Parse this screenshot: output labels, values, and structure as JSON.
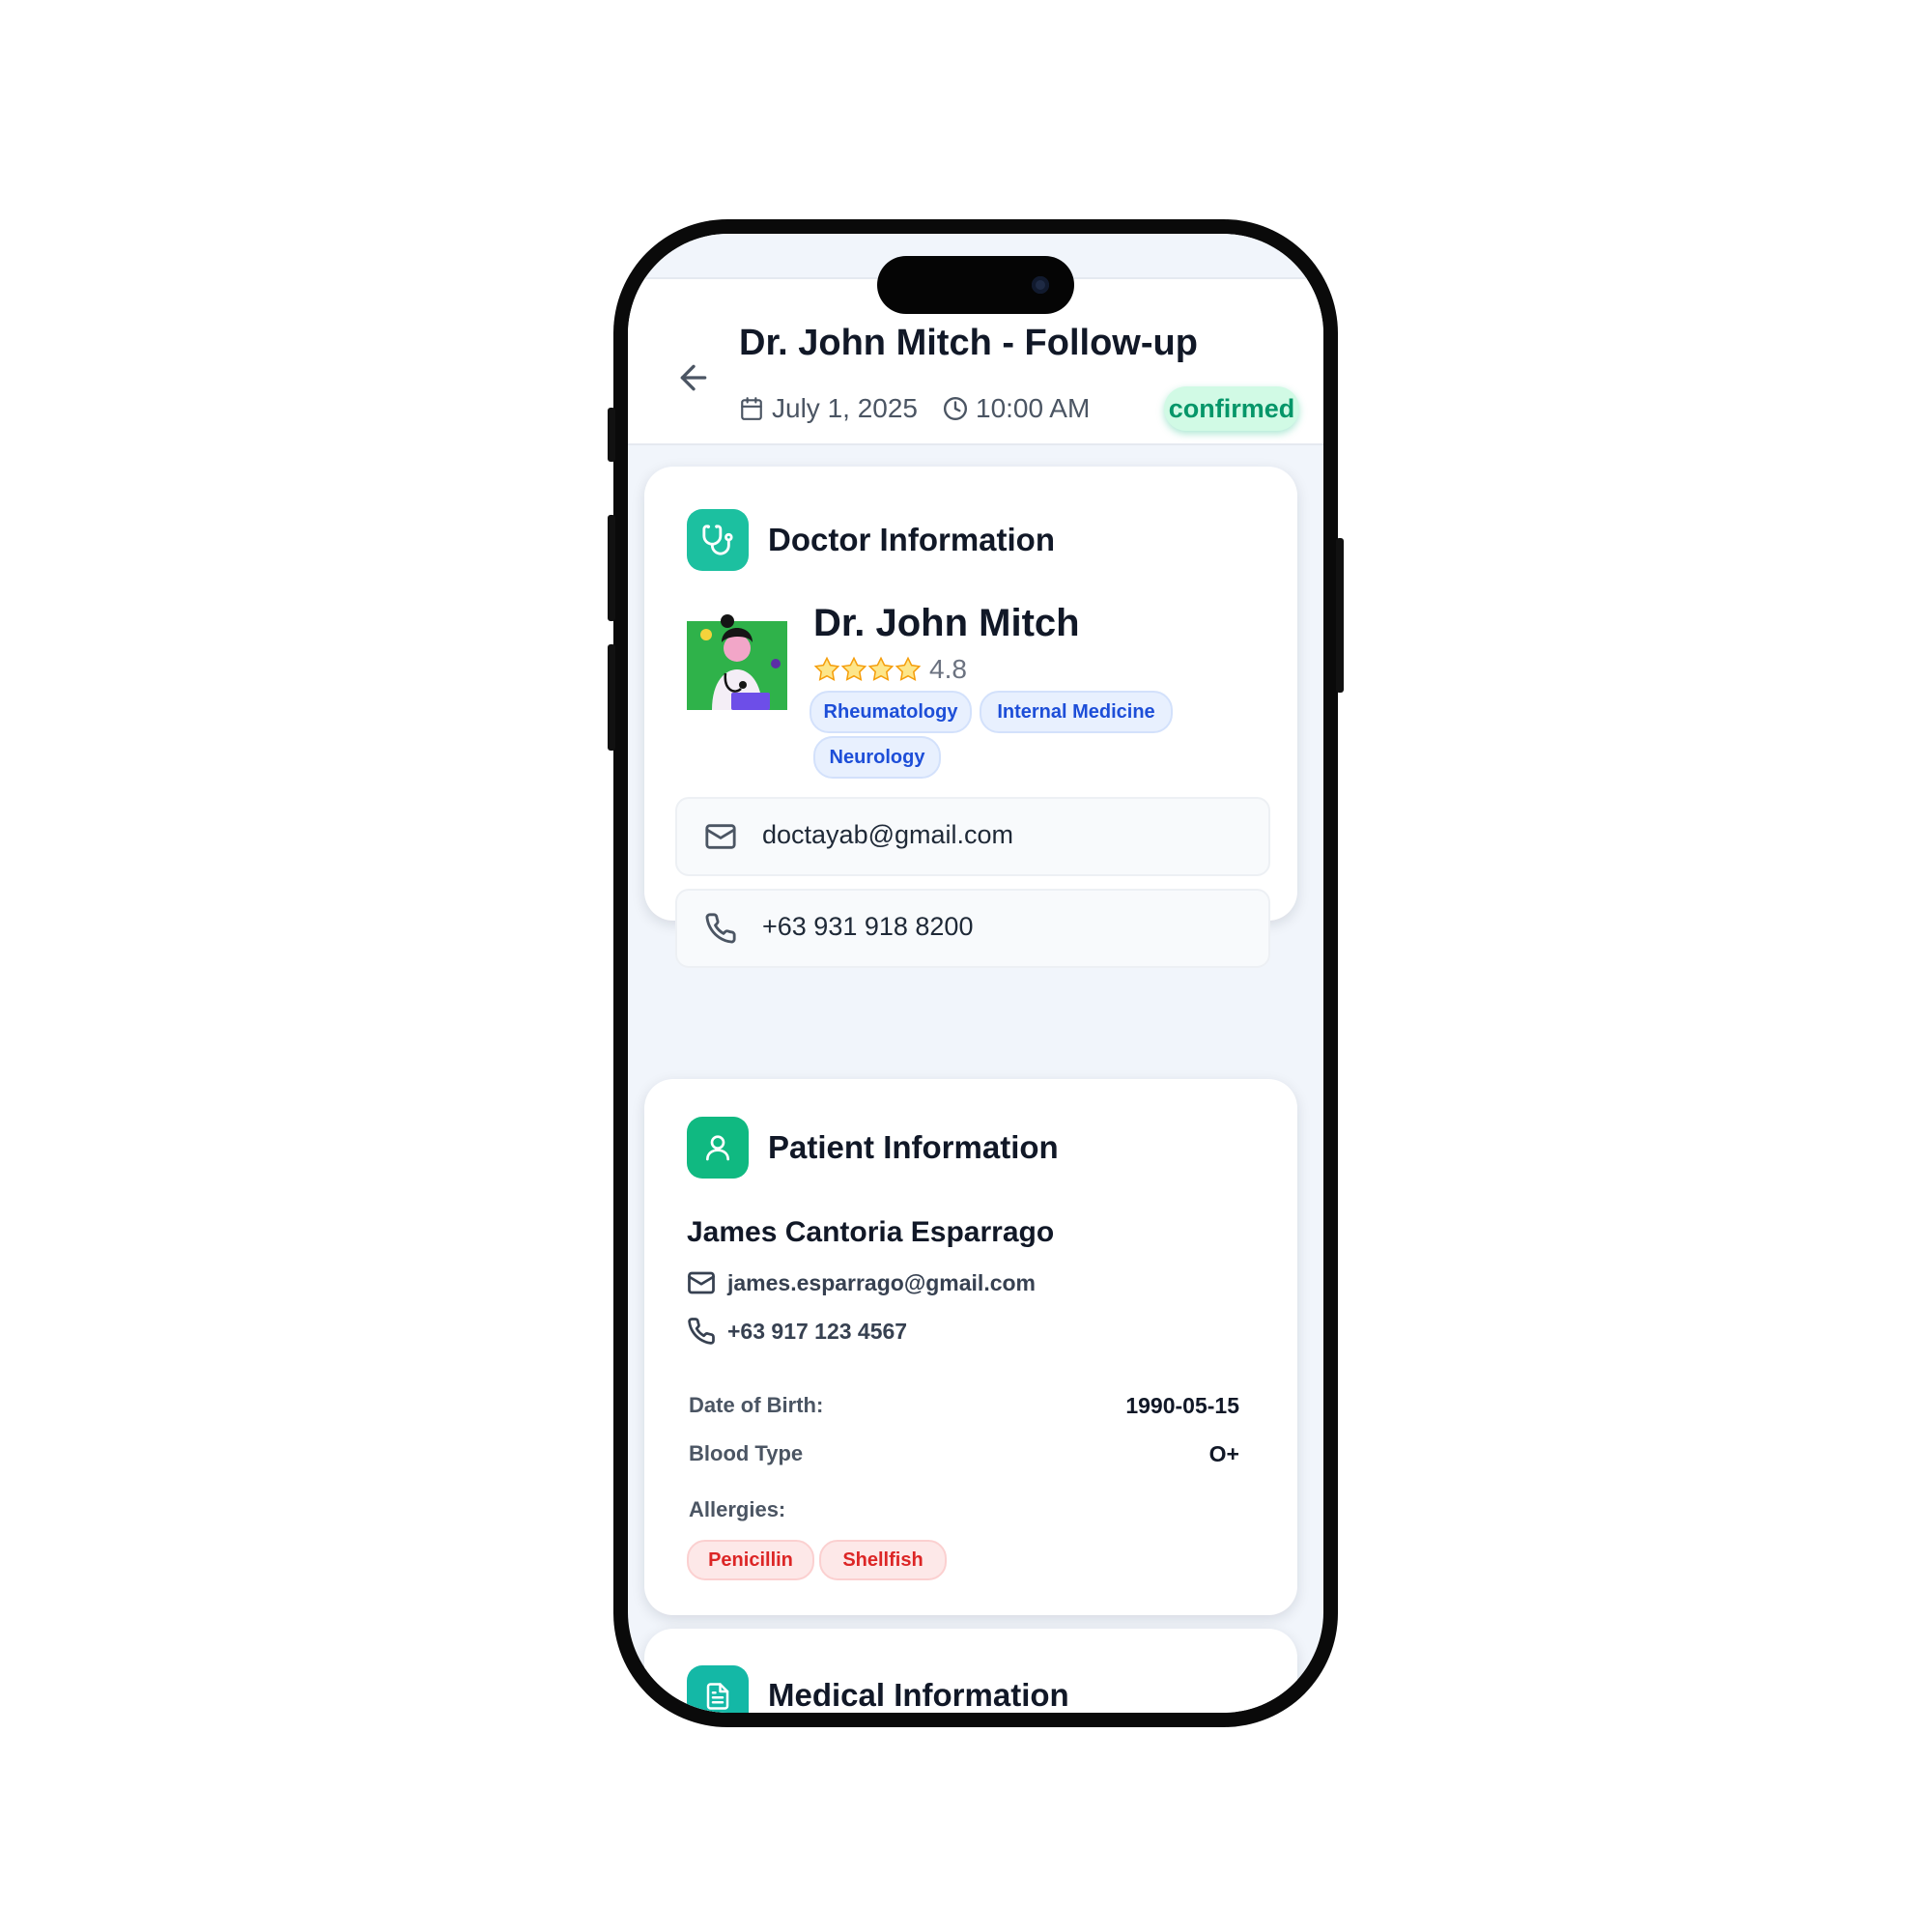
{
  "header": {
    "title": "Dr. John Mitch - Follow-up",
    "date": "July 1, 2025",
    "time": "10:00 AM",
    "status": "confirmed"
  },
  "doctor_card": {
    "title": "Doctor Information",
    "name": "Dr. John Mitch",
    "rating": "4.8",
    "rating_stars": 4,
    "specialties": [
      "Rheumatology",
      "Internal Medicine",
      "Neurology"
    ],
    "email": "doctayab@gmail.com",
    "phone": "+63 931 918 8200"
  },
  "patient_card": {
    "title": "Patient Information",
    "name": "James Cantoria Esparrago",
    "email": "james.esparrago@gmail.com",
    "phone": "+63 917 123 4567",
    "dob_label": "Date of Birth:",
    "dob": "1990-05-15",
    "blood_label": "Blood Type",
    "blood": "O+",
    "allergies_label": "Allergies:",
    "allergies": [
      "Penicillin",
      "Shellfish"
    ]
  },
  "medical_card": {
    "title": "Medical Information"
  },
  "icons": {
    "back": "arrow-left-icon",
    "calendar": "calendar-icon",
    "clock": "clock-icon",
    "stethoscope": "stethoscope-icon",
    "user": "user-icon",
    "document": "document-icon",
    "mail": "mail-icon",
    "phone": "phone-icon",
    "star": "star-icon"
  },
  "colors": {
    "accent_teal": "#14b8a6",
    "accent_green": "#10b981",
    "status_bg": "#d1fae5",
    "status_text": "#059669",
    "tag_blue": "#1d4ed8",
    "tag_red": "#dc2626"
  }
}
